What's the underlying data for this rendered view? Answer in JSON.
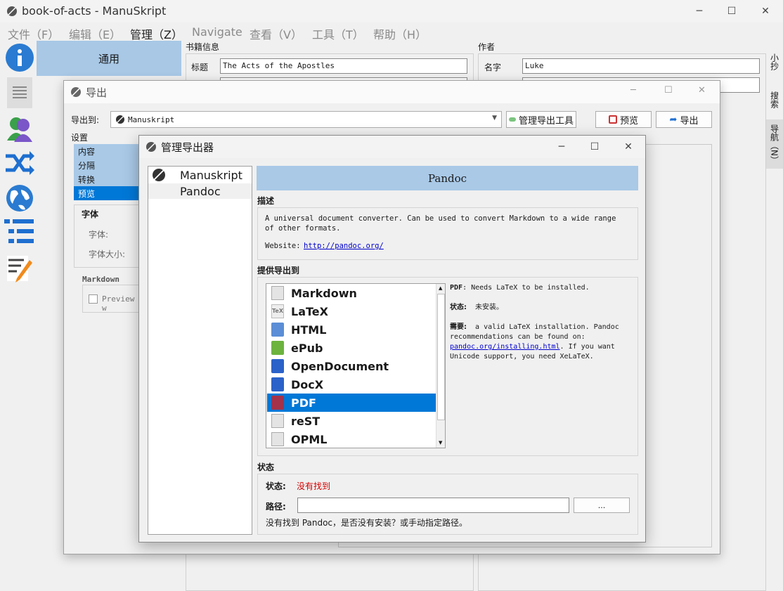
{
  "window": {
    "title": "book-of-acts - ManuSkript"
  },
  "menu": [
    "文件（F）",
    "编辑（E）",
    "管理（Z）",
    "Navigate",
    "查看（V）",
    "工具（T）",
    "帮助（H）"
  ],
  "left_tab": {
    "label": "通用"
  },
  "book_info": {
    "header": "书籍信息",
    "title_label": "标题",
    "title_value": "The Acts of the Apostles"
  },
  "author": {
    "header": "作者",
    "name_label": "名字",
    "name_value": "Luke"
  },
  "right_tabs": [
    "小抄",
    "搜索",
    "导航（N）"
  ],
  "export_dialog": {
    "title": "导出",
    "export_to_label": "导出到:",
    "export_to_value": "Manuskript",
    "manage_button": "管理导出工具",
    "preview_button": "预览",
    "export_button": "导出",
    "settings_label": "设置",
    "settings_items": [
      "内容",
      "分隔",
      "转换",
      "预览"
    ],
    "font_group": "字体",
    "font_label": "字体:",
    "font_size_label": "字体大小:",
    "markdown_group": "Markdown",
    "preview_checkbox": "Preview w"
  },
  "manager_dialog": {
    "title": "管理导出器",
    "exporters": [
      "Manuskript",
      "Pandoc"
    ],
    "selected_exporter": "Pandoc",
    "header": "Pandoc",
    "description_label": "描述",
    "description_text": "A universal document converter. Can be used to convert Markdown to a wide range of other formats.",
    "website_label": "Website:",
    "website_url": "http://pandoc.org/",
    "provides_label": "提供导出到",
    "formats": [
      "Markdown",
      "LaTeX",
      "HTML",
      "ePub",
      "OpenDocument",
      "DocX",
      "PDF",
      "reST",
      "OPML"
    ],
    "selected_format": "PDF",
    "info_format": "PDF",
    "info_format_text": ": Needs LaTeX to be installed.",
    "info_status_label": "状态:",
    "info_status_value": "未安装。",
    "info_needs_label": "需要:",
    "info_needs_text": "a valid LaTeX installation. Pandoc recommendations can be found on:",
    "info_link": "pandoc.org/installing.html",
    "info_tail": ". If you want Unicode support, you need XeLaTeX.",
    "status_section": "状态",
    "status_label": "状态:",
    "status_value": "没有找到",
    "path_label": "路径:",
    "path_value": "",
    "browse_button": "...",
    "hint": "没有找到 Pandoc，是否没有安装？或手动指定路径。"
  },
  "colors": {
    "selection": "#0078d7",
    "tab_blue": "#a8c8e6",
    "header_blue": "#a9c9e7",
    "error": "#d40000",
    "link": "#0000cc"
  }
}
